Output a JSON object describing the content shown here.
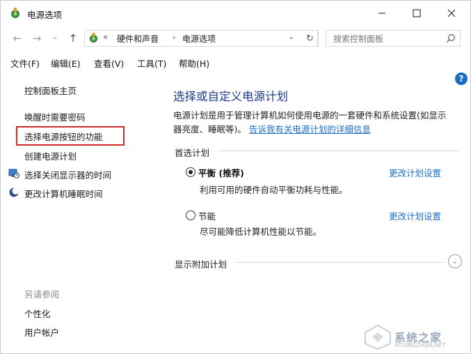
{
  "window": {
    "title": "电源选项"
  },
  "nav": {
    "back": "←",
    "forward": "→",
    "dropdown": "⌄",
    "up": "↑",
    "breadcrumbs": [
      "硬件和声音",
      "电源选项"
    ],
    "search_placeholder": "搜索控制面板"
  },
  "menubar": [
    "文件(F)",
    "编辑(E)",
    "查看(V)",
    "工具(T)",
    "帮助(H)"
  ],
  "help_label": "?",
  "sidebar": {
    "home": "控制面板主页",
    "links": [
      "唤醒时需要密码",
      "选择电源按钮的功能",
      "创建电源计划",
      "选择关闭显示器的时间",
      "更改计算机睡眠时间"
    ],
    "see_also_title": "另请参阅",
    "see_also": [
      "个性化",
      "用户帐户"
    ]
  },
  "main": {
    "title": "选择或自定义电源计划",
    "desc_line1": "电源计划是用于管理计算机如何使用电源的一套硬件和系统设置(如显示",
    "desc_line2": "器亮度、睡眠等)。",
    "desc_link": "告诉我有关电源计划的详细信息",
    "preferred_label": "首选计划",
    "plans": [
      {
        "name": "平衡 (推荐)",
        "desc": "利用可用的硬件自动平衡功耗与性能。",
        "link": "更改计划设置",
        "selected": true
      },
      {
        "name": "节能",
        "desc": "尽可能降低计算机性能以节能。",
        "link": "更改计划设置",
        "selected": false
      }
    ],
    "additional_label": "显示附加计划"
  },
  "watermark": {
    "text": "系统之家",
    "sub": "XITONGZHIJIA.NET"
  },
  "colors": {
    "link": "#1a6fc2",
    "title": "#1e3b8a",
    "highlight": "#d22a2a"
  }
}
